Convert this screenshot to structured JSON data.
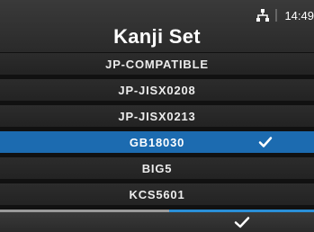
{
  "header": {
    "title": "Kanji Set",
    "clock": "14:49",
    "icons": [
      "network-icon"
    ]
  },
  "list": {
    "items": [
      {
        "label": "JP-COMPATIBLE",
        "selected": false
      },
      {
        "label": "JP-JISX0208",
        "selected": false
      },
      {
        "label": "JP-JISX0213",
        "selected": false
      },
      {
        "label": "GB18030",
        "selected": true
      },
      {
        "label": "BIG5",
        "selected": false
      },
      {
        "label": "KCS5601",
        "selected": false
      }
    ]
  },
  "footer": {
    "left_action": "",
    "right_action_icon": "check-icon"
  },
  "colors": {
    "selected": "#1c6bb0",
    "accent": "#2a8fd8"
  }
}
